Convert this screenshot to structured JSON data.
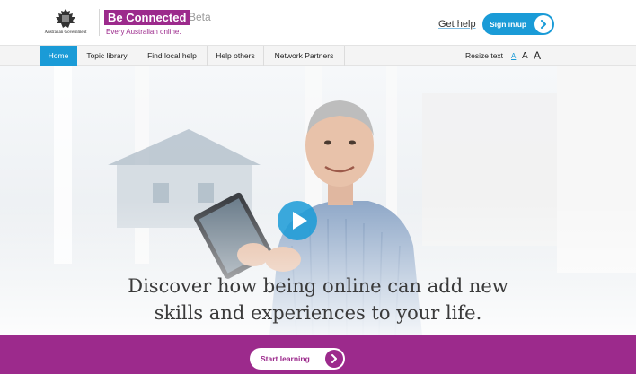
{
  "header": {
    "gov_name": "Australian Government",
    "brand_name": "Be Connected",
    "brand_beta": "Beta",
    "brand_tagline": "Every Australian online.",
    "get_help": "Get help",
    "sign_in": "Sign in/up"
  },
  "nav": {
    "items": [
      {
        "label": "Home",
        "active": true
      },
      {
        "label": "Topic library"
      },
      {
        "label": "Find local help"
      },
      {
        "label": "Help others"
      },
      {
        "label": "Network Partners"
      }
    ],
    "resize_label": "Resize text",
    "resize_sizes": [
      "A",
      "A",
      "A"
    ]
  },
  "hero": {
    "caption_line1": "Discover how being online can add new",
    "caption_line2": "skills and experiences to your life."
  },
  "cta": {
    "start_learning": "Start learning"
  },
  "colors": {
    "brand_purple": "#9c2a8c",
    "accent_blue": "#1a9bd7"
  },
  "icons": [
    "crest-icon",
    "chevron-right-icon",
    "play-icon"
  ]
}
